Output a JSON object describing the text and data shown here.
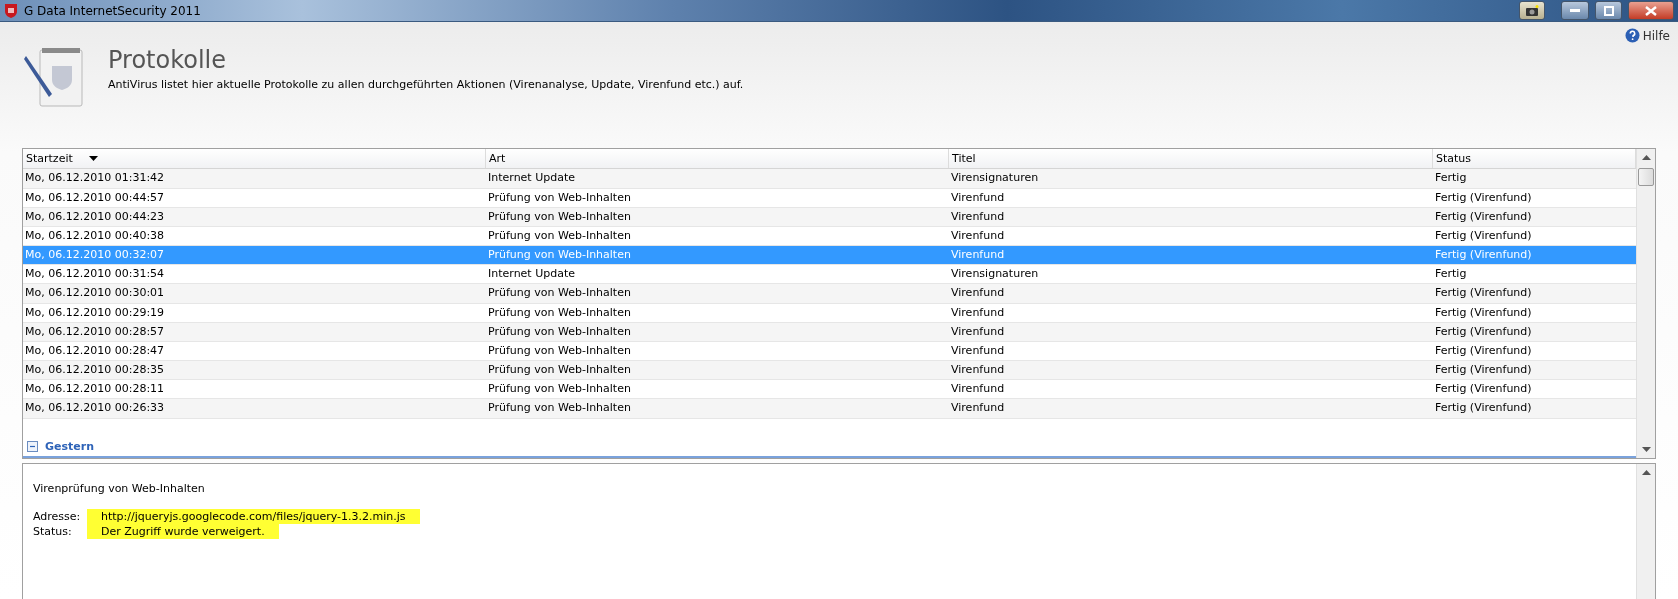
{
  "window": {
    "title": "G Data InternetSecurity 2011"
  },
  "help": {
    "label": "Hilfe"
  },
  "header": {
    "title": "Protokolle",
    "description": "AntiVirus listet hier aktuelle Protokolle zu allen durchgeführten Aktionen (Virenanalyse, Update, Virenfund etc.) auf."
  },
  "table": {
    "columns": [
      {
        "label": "Startzeit",
        "sorted": true
      },
      {
        "label": "Art",
        "sorted": false
      },
      {
        "label": "Titel",
        "sorted": false
      },
      {
        "label": "Status",
        "sorted": false
      }
    ],
    "rows": [
      {
        "cells": [
          "Mo, 06.12.2010 01:31:42",
          "Internet Update",
          "Virensignaturen",
          "Fertig"
        ],
        "selected": false
      },
      {
        "cells": [
          "Mo, 06.12.2010 00:44:57",
          "Prüfung von Web-Inhalten",
          "Virenfund",
          "Fertig (Virenfund)"
        ],
        "selected": false
      },
      {
        "cells": [
          "Mo, 06.12.2010 00:44:23",
          "Prüfung von Web-Inhalten",
          "Virenfund",
          "Fertig (Virenfund)"
        ],
        "selected": false
      },
      {
        "cells": [
          "Mo, 06.12.2010 00:40:38",
          "Prüfung von Web-Inhalten",
          "Virenfund",
          "Fertig (Virenfund)"
        ],
        "selected": false
      },
      {
        "cells": [
          "Mo, 06.12.2010 00:32:07",
          "Prüfung von Web-Inhalten",
          "Virenfund",
          "Fertig (Virenfund)"
        ],
        "selected": true
      },
      {
        "cells": [
          "Mo, 06.12.2010 00:31:54",
          "Internet Update",
          "Virensignaturen",
          "Fertig"
        ],
        "selected": false
      },
      {
        "cells": [
          "Mo, 06.12.2010 00:30:01",
          "Prüfung von Web-Inhalten",
          "Virenfund",
          "Fertig (Virenfund)"
        ],
        "selected": false
      },
      {
        "cells": [
          "Mo, 06.12.2010 00:29:19",
          "Prüfung von Web-Inhalten",
          "Virenfund",
          "Fertig (Virenfund)"
        ],
        "selected": false
      },
      {
        "cells": [
          "Mo, 06.12.2010 00:28:57",
          "Prüfung von Web-Inhalten",
          "Virenfund",
          "Fertig (Virenfund)"
        ],
        "selected": false
      },
      {
        "cells": [
          "Mo, 06.12.2010 00:28:47",
          "Prüfung von Web-Inhalten",
          "Virenfund",
          "Fertig (Virenfund)"
        ],
        "selected": false
      },
      {
        "cells": [
          "Mo, 06.12.2010 00:28:35",
          "Prüfung von Web-Inhalten",
          "Virenfund",
          "Fertig (Virenfund)"
        ],
        "selected": false
      },
      {
        "cells": [
          "Mo, 06.12.2010 00:28:11",
          "Prüfung von Web-Inhalten",
          "Virenfund",
          "Fertig (Virenfund)"
        ],
        "selected": false
      },
      {
        "cells": [
          "Mo, 06.12.2010 00:26:33",
          "Prüfung von Web-Inhalten",
          "Virenfund",
          "Fertig (Virenfund)"
        ],
        "selected": false
      }
    ],
    "group": {
      "label": "Gestern",
      "expanded": true
    }
  },
  "details": {
    "title": "Virenprüfung von Web-Inhalten",
    "fields": [
      {
        "label": "Adresse:",
        "value": "http://jqueryjs.googlecode.com/files/jquery-1.3.2.min.js",
        "highlighted": true
      },
      {
        "label": "Status:",
        "value": "Der Zugriff wurde verweigert.",
        "highlighted": true
      }
    ]
  }
}
